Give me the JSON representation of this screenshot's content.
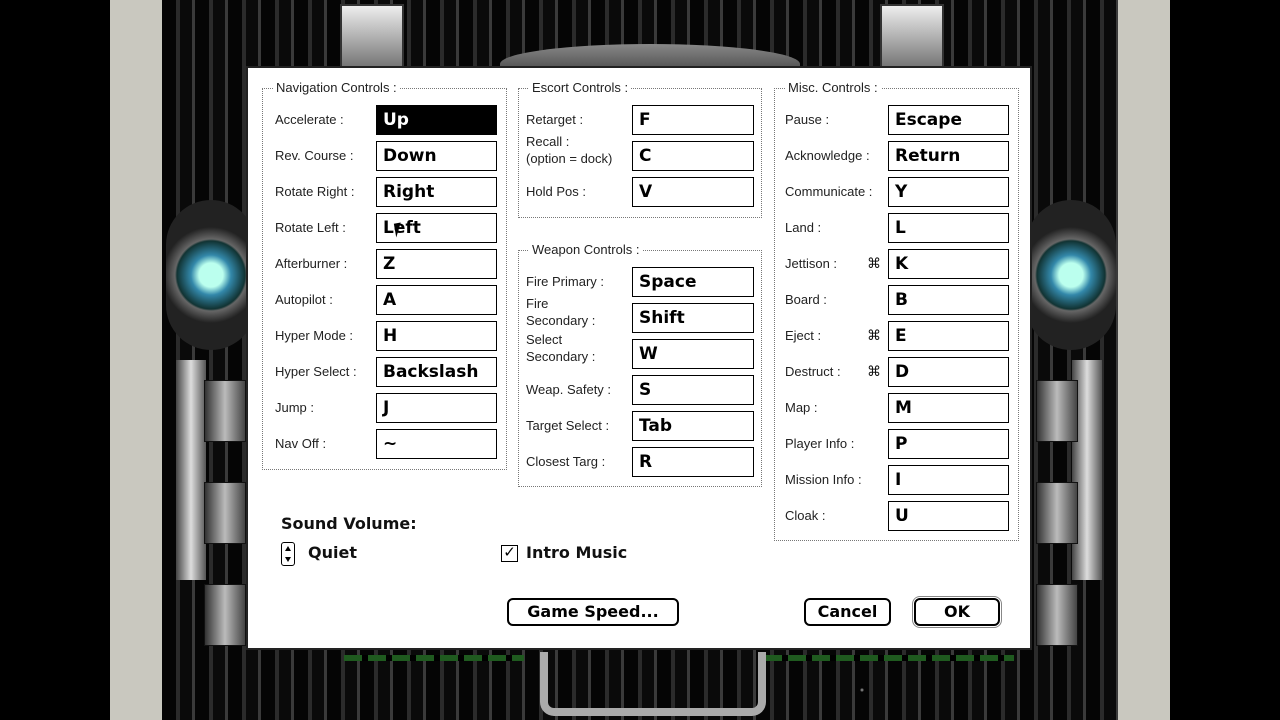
{
  "navigation": {
    "title": "Navigation Controls :",
    "rows": [
      {
        "label": "Accelerate :",
        "key": "Up"
      },
      {
        "label": "Rev. Course :",
        "key": "Down"
      },
      {
        "label": "Rotate Right :",
        "key": "Right"
      },
      {
        "label": "Rotate Left :",
        "key": "Left"
      },
      {
        "label": "Afterburner :",
        "key": "Z"
      },
      {
        "label": "Autopilot :",
        "key": "A"
      },
      {
        "label": "Hyper Mode :",
        "key": "H"
      },
      {
        "label": "Hyper Select :",
        "key": "Backslash"
      },
      {
        "label": "Jump :",
        "key": "J"
      },
      {
        "label": "Nav Off :",
        "key": "~"
      }
    ]
  },
  "escort": {
    "title": "Escort Controls :",
    "rows": [
      {
        "label": "Retarget :",
        "key": "F"
      },
      {
        "label": "Recall :",
        "label2": "(option = dock)",
        "key": "C"
      },
      {
        "label": "Hold Pos :",
        "key": "V"
      }
    ]
  },
  "weapon": {
    "title": "Weapon Controls :",
    "rows": [
      {
        "label": "Fire Primary :",
        "key": "Space"
      },
      {
        "label": "Fire",
        "label2": "Secondary :",
        "key": "Shift"
      },
      {
        "label": "Select",
        "label2": "Secondary :",
        "key": "W"
      },
      {
        "label": "Weap. Safety :",
        "key": "S"
      },
      {
        "label": "Target Select :",
        "key": "Tab"
      },
      {
        "label": "Closest Targ :",
        "key": "R"
      }
    ]
  },
  "misc": {
    "title": "Misc. Controls :",
    "command_glyph": "⌘",
    "rows": [
      {
        "label": "Pause :",
        "key": "Escape"
      },
      {
        "label": "Acknowledge :",
        "key": "Return"
      },
      {
        "label": "Communicate :",
        "key": "Y"
      },
      {
        "label": "Land :",
        "key": "L"
      },
      {
        "label": "Jettison :",
        "key": "K",
        "command": true
      },
      {
        "label": "Board :",
        "key": "B"
      },
      {
        "label": "Eject :",
        "key": "E",
        "command": true
      },
      {
        "label": "Destruct :",
        "key": "D",
        "command": true
      },
      {
        "label": "Map :",
        "key": "M"
      },
      {
        "label": "Player Info :",
        "key": "P"
      },
      {
        "label": "Mission Info :",
        "key": "I"
      },
      {
        "label": "Cloak :",
        "key": "U"
      }
    ]
  },
  "sound": {
    "label": "Sound Volume:",
    "value": "Quiet",
    "intro_music_label": "Intro Music",
    "intro_music_checked": true,
    "check_glyph": "✓"
  },
  "buttons": {
    "game_speed": "Game Speed...",
    "cancel": "Cancel",
    "ok": "OK"
  }
}
